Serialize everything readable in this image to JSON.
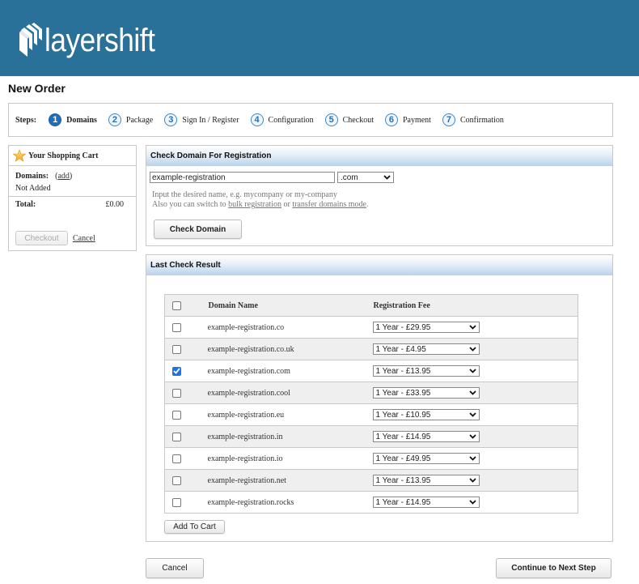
{
  "brand": {
    "name": "layershift",
    "logo_icon": "layers-stack-icon",
    "header_color": "#2a7199"
  },
  "page": {
    "title": "New Order"
  },
  "steps": {
    "label": "Steps:",
    "items": [
      {
        "num": "1",
        "label": "Domains",
        "active": true
      },
      {
        "num": "2",
        "label": "Package",
        "active": false
      },
      {
        "num": "3",
        "label": "Sign In / Register",
        "active": false
      },
      {
        "num": "4",
        "label": "Configuration",
        "active": false
      },
      {
        "num": "5",
        "label": "Checkout",
        "active": false
      },
      {
        "num": "6",
        "label": "Payment",
        "active": false
      },
      {
        "num": "7",
        "label": "Confirmation",
        "active": false
      }
    ]
  },
  "cart": {
    "title": "Your Shopping Cart",
    "icon": "star-icon",
    "domains_label": "Domains:",
    "add_link": "add",
    "domains_status": "Not Added",
    "total_label": "Total:",
    "total_value": "£0.00",
    "checkout_label": "Checkout",
    "cancel_label": "Cancel"
  },
  "check_domain": {
    "title": "Check Domain For Registration",
    "input_value": "example-registration",
    "tld_selected": ".com",
    "hint_line1": "Input the desired name, e.g. mycompany or my-company",
    "hint_line2_prefix": "Also you can switch to ",
    "bulk_link": "bulk registration",
    "hint_or": " or ",
    "transfer_link": "transfer domains mode",
    "hint_suffix": ".",
    "button_label": "Check Domain"
  },
  "results": {
    "title": "Last Check Result",
    "columns": {
      "domain": "Domain Name",
      "fee": "Registration Fee"
    },
    "rows": [
      {
        "domain": "example-registration.co",
        "fee": "1 Year - £29.95",
        "checked": false
      },
      {
        "domain": "example-registration.co.uk",
        "fee": "1 Year - £4.95",
        "checked": false
      },
      {
        "domain": "example-registration.com",
        "fee": "1 Year - £13.95",
        "checked": true
      },
      {
        "domain": "example-registration.cool",
        "fee": "1 Year - £33.95",
        "checked": false
      },
      {
        "domain": "example-registration.eu",
        "fee": "1 Year - £10.95",
        "checked": false
      },
      {
        "domain": "example-registration.in",
        "fee": "1 Year - £14.95",
        "checked": false
      },
      {
        "domain": "example-registration.io",
        "fee": "1 Year - £49.95",
        "checked": false
      },
      {
        "domain": "example-registration.net",
        "fee": "1 Year - £13.95",
        "checked": false
      },
      {
        "domain": "example-registration.rocks",
        "fee": "1 Year - £14.95",
        "checked": false
      }
    ],
    "add_to_cart_label": "Add To Cart"
  },
  "footer": {
    "cancel_label": "Cancel",
    "continue_label": "Continue to Next Step"
  }
}
